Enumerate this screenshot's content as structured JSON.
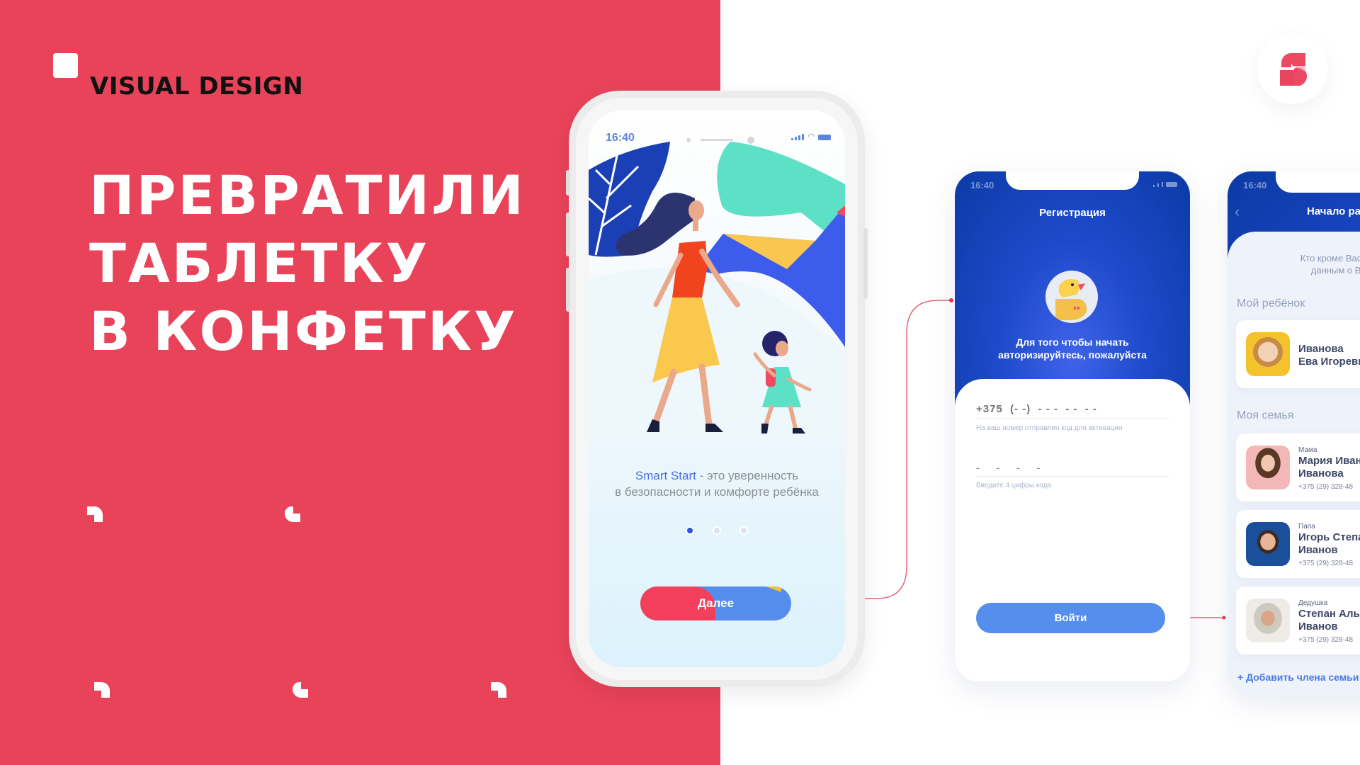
{
  "colors": {
    "brand_red": "#e9435a",
    "primary_blue": "#568eed",
    "deep_blue": "#0b3aa6",
    "accent_teal": "#5ce0c6",
    "accent_yellow": "#f9c74f"
  },
  "hero": {
    "eyebrow": "VISUAL DESIGN",
    "headline_lines": [
      "ПРЕВРАТИЛИ",
      "ТАБЛЕТКУ",
      "В КОНФЕТКУ"
    ]
  },
  "logo": {
    "icon": "smart-start-s-logo"
  },
  "onboarding_screen": {
    "status_time": "16:40",
    "tagline_brand": "Smart Start",
    "tagline_rest_line1": " - это уверенность",
    "tagline_line2": "в безопасности и комфорте ребёнка",
    "pager": {
      "total": 3,
      "active_index": 0
    },
    "next_button": "Далее"
  },
  "registration_screen": {
    "status_time": "16:40",
    "title": "Регистрация",
    "message_line1": "Для того чтобы начать",
    "message_line2": "авторизируйтесь, пожалуйста",
    "phone_placeholder": "+375  (- -)  - - -  - -  - -",
    "phone_hint": "На ваш номер отправлен код для активации",
    "code_placeholder": "- - - -",
    "code_hint": "Введите 4 цифры кода",
    "login_button": "Войти"
  },
  "family_screen": {
    "status_time": "16:40",
    "title": "Начало работы",
    "intro_line1": "Кто кроме Вас будет и",
    "intro_line2": "данным о Вашем",
    "my_child_label": "Мой ребёнок",
    "child": {
      "name_line1": "Иванова",
      "name_line2": "Ева Игоревна"
    },
    "my_family_label": "Моя семья",
    "members": [
      {
        "role": "Мама",
        "name_line1": "Мария Ивановна",
        "name_line2": "Иванова",
        "phone": "+375 (29) 328-48"
      },
      {
        "role": "Папа",
        "name_line1": "Игорь Степанович",
        "name_line2": "Иванов",
        "phone": "+375 (29) 328-48"
      },
      {
        "role": "Дедушка",
        "name_line1": "Степан Альбертович",
        "name_line2": "Иванов",
        "phone": "+375 (29) 328-48"
      }
    ],
    "add_member_link": "+ Добавить члена семьи"
  }
}
